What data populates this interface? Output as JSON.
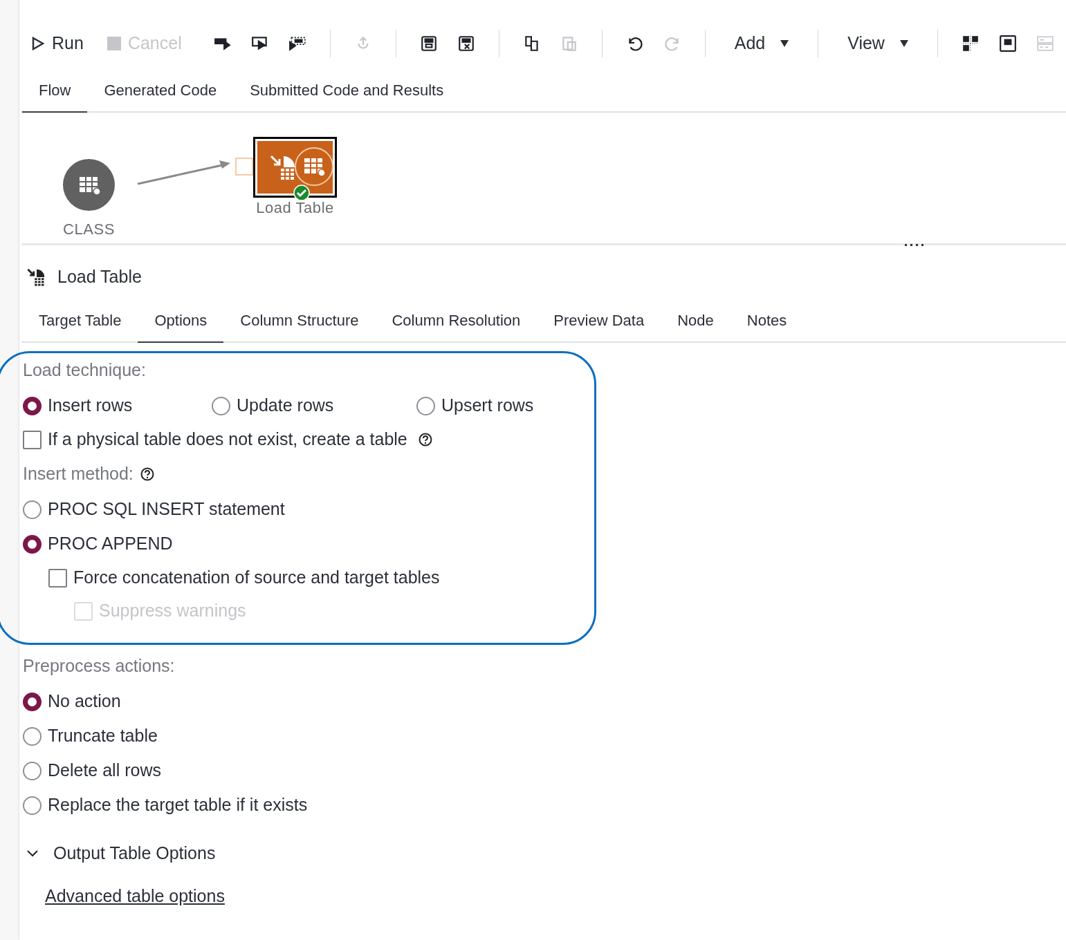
{
  "toolbar": [
    {
      "kind": "button",
      "label": "Run",
      "disabled": false
    },
    {
      "kind": "button",
      "label": "Cancel",
      "disabled": true
    },
    {
      "kind": "icon",
      "disabled": false
    },
    {
      "kind": "icon",
      "disabled": false
    },
    {
      "kind": "icon",
      "disabled": false
    },
    {
      "kind": "separator"
    },
    {
      "kind": "icon",
      "disabled": true
    },
    {
      "kind": "separator"
    },
    {
      "kind": "icon",
      "disabled": false
    },
    {
      "kind": "icon",
      "disabled": false
    },
    {
      "kind": "separator"
    },
    {
      "kind": "icon",
      "disabled": false
    },
    {
      "kind": "icon",
      "disabled": true
    },
    {
      "kind": "separator"
    },
    {
      "kind": "icon",
      "disabled": false
    },
    {
      "kind": "icon",
      "disabled": true
    },
    {
      "kind": "separator"
    },
    {
      "kind": "dropdown",
      "label": "Add"
    },
    {
      "kind": "separator"
    },
    {
      "kind": "dropdown",
      "label": "View"
    },
    {
      "kind": "separator"
    },
    {
      "kind": "icon",
      "disabled": false
    },
    {
      "kind": "icon",
      "disabled": false
    },
    {
      "kind": "icon",
      "disabled": true
    }
  ],
  "tabs": [
    {
      "label": "Flow",
      "selected": true
    },
    {
      "label": "Generated Code",
      "selected": false
    },
    {
      "label": "Submitted Code and Results",
      "selected": false
    }
  ],
  "flow": {
    "nodes": [
      {
        "label": "CLASS",
        "kind": "table",
        "selected": false,
        "succeeded": false
      },
      {
        "label": "Load Table",
        "kind": "step",
        "selected": true,
        "succeeded": true
      }
    ]
  },
  "panel": {
    "title": "Load Table",
    "tabs": [
      {
        "label": "Target Table",
        "selected": false
      },
      {
        "label": "Options",
        "selected": true
      },
      {
        "label": "Column Structure",
        "selected": false
      },
      {
        "label": "Column Resolution",
        "selected": false
      },
      {
        "label": "Preview Data",
        "selected": false
      },
      {
        "label": "Node",
        "selected": false
      },
      {
        "label": "Notes",
        "selected": false
      }
    ],
    "highlighted_options": [
      {
        "kind": "label",
        "text": "Load technique:"
      },
      {
        "kind": "radio_row",
        "options": [
          {
            "label": "Insert rows",
            "selected": true
          },
          {
            "label": "Update rows",
            "selected": false
          },
          {
            "label": "Upsert rows",
            "selected": false
          }
        ]
      },
      {
        "kind": "checkbox",
        "label": "If a physical table does not exist, create a table",
        "checked": false,
        "disabled": false,
        "help": true
      },
      {
        "kind": "label",
        "text": "Insert method:",
        "help": true
      },
      {
        "kind": "radio",
        "label": "PROC SQL INSERT statement",
        "selected": false
      },
      {
        "kind": "radio",
        "label": "PROC APPEND",
        "selected": true,
        "children": [
          {
            "kind": "checkbox",
            "label": "Force concatenation of source and target tables",
            "checked": false,
            "disabled": false,
            "children": [
              {
                "kind": "checkbox",
                "label": "Suppress warnings",
                "checked": false,
                "disabled": true
              }
            ]
          }
        ]
      }
    ],
    "options": [
      {
        "kind": "label",
        "text": "Preprocess actions:"
      },
      {
        "kind": "radio",
        "label": "No action",
        "selected": true
      },
      {
        "kind": "radio",
        "label": "Truncate table",
        "selected": false
      },
      {
        "kind": "radio",
        "label": "Delete all rows",
        "selected": false
      },
      {
        "kind": "radio",
        "label": "Replace the target table if it exists",
        "selected": false
      }
    ],
    "section": {
      "title": "Output Table Options",
      "expanded": true,
      "link": "Advanced table options"
    }
  }
}
